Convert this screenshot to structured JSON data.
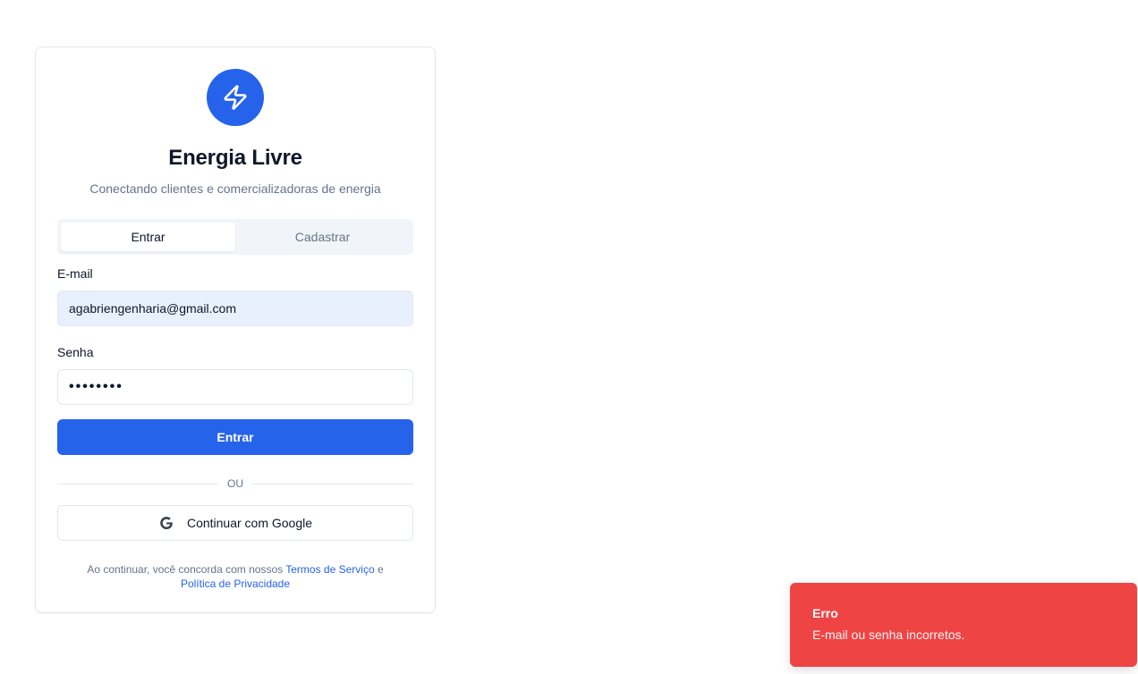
{
  "app": {
    "title": "Energia Livre",
    "subtitle": "Conectando clientes e comercializadoras de energia",
    "logo_icon": "lightning-bolt-icon",
    "brand_color": "#2563eb"
  },
  "tabs": [
    {
      "label": "Entrar",
      "active": true
    },
    {
      "label": "Cadastrar",
      "active": false
    }
  ],
  "form": {
    "email_label": "E-mail",
    "email_value": "agabriengenharia@gmail.com",
    "password_label": "Senha",
    "password_value": "••••••••",
    "submit_label": "Entrar"
  },
  "divider_text": "OU",
  "google_button": {
    "label": "Continuar com Google",
    "icon": "google-icon"
  },
  "legal": {
    "prefix": "Ao continuar, você concorda com nossos ",
    "terms_link": "Termos de Serviço",
    "conjunction": " e",
    "privacy_link": "Política de Privacidade"
  },
  "toast": {
    "title": "Erro",
    "message": "E-mail ou senha incorretos.",
    "color": "#ef4444"
  }
}
